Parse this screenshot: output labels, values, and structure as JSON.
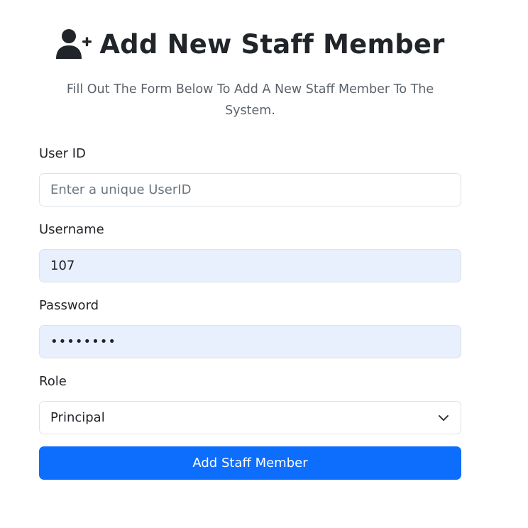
{
  "header": {
    "title": "Add New Staff Member",
    "icon": "user-plus-icon",
    "subtitle": "Fill Out The Form Below To Add A New Staff Member To The System."
  },
  "form": {
    "user_id": {
      "label": "User ID",
      "value": "",
      "placeholder": "Enter a unique UserID"
    },
    "username": {
      "label": "Username",
      "value": "107"
    },
    "password": {
      "label": "Password",
      "value": "••••••••"
    },
    "role": {
      "label": "Role",
      "selected": "Principal",
      "icon": "chevron-down-icon"
    },
    "submit_label": "Add Staff Member"
  },
  "colors": {
    "primary": "#0d6efd",
    "autofill_bg": "#e8f0fe",
    "text": "#212529",
    "muted": "#5c636a",
    "border": "#dee2e6"
  }
}
